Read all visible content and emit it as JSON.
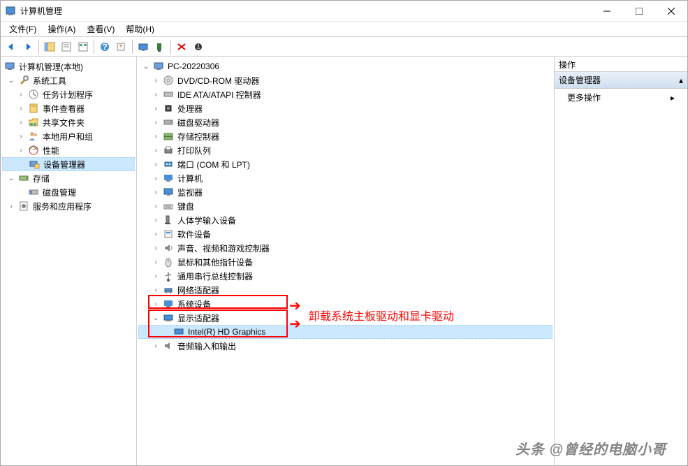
{
  "window": {
    "title": "计算机管理"
  },
  "menu": {
    "file": "文件(F)",
    "action": "操作(A)",
    "view": "查看(V)",
    "help": "帮助(H)"
  },
  "left_tree": {
    "root": "计算机管理(本地)",
    "system_tools": "系统工具",
    "task_scheduler": "任务计划程序",
    "event_viewer": "事件查看器",
    "shared_folders": "共享文件夹",
    "local_users": "本地用户和组",
    "performance": "性能",
    "device_manager": "设备管理器",
    "storage": "存储",
    "disk_mgmt": "磁盘管理",
    "services_apps": "服务和应用程序"
  },
  "mid_tree": {
    "root": "PC-20220306",
    "dvd": "DVD/CD-ROM 驱动器",
    "ide": "IDE ATA/ATAPI 控制器",
    "cpu": "处理器",
    "disk_drives": "磁盘驱动器",
    "storage_ctrl": "存储控制器",
    "print_queue": "打印队列",
    "ports": "端口 (COM 和 LPT)",
    "computer": "计算机",
    "monitor": "监视器",
    "keyboard": "键盘",
    "hid": "人体学输入设备",
    "software_dev": "软件设备",
    "sound": "声音、视频和游戏控制器",
    "mouse": "鼠标和其他指针设备",
    "usb": "通用串行总线控制器",
    "network": "网络适配器",
    "system_dev": "系统设备",
    "display": "显示适配器",
    "intel_hd": "Intel(R) HD Graphics",
    "audio_io": "音频输入和输出"
  },
  "actions": {
    "header": "操作",
    "section": "设备管理器",
    "more": "更多操作"
  },
  "annotation": {
    "text": "卸载系统主板驱动和显卡驱动"
  },
  "watermark": "头条 @曾经的电脑小哥"
}
